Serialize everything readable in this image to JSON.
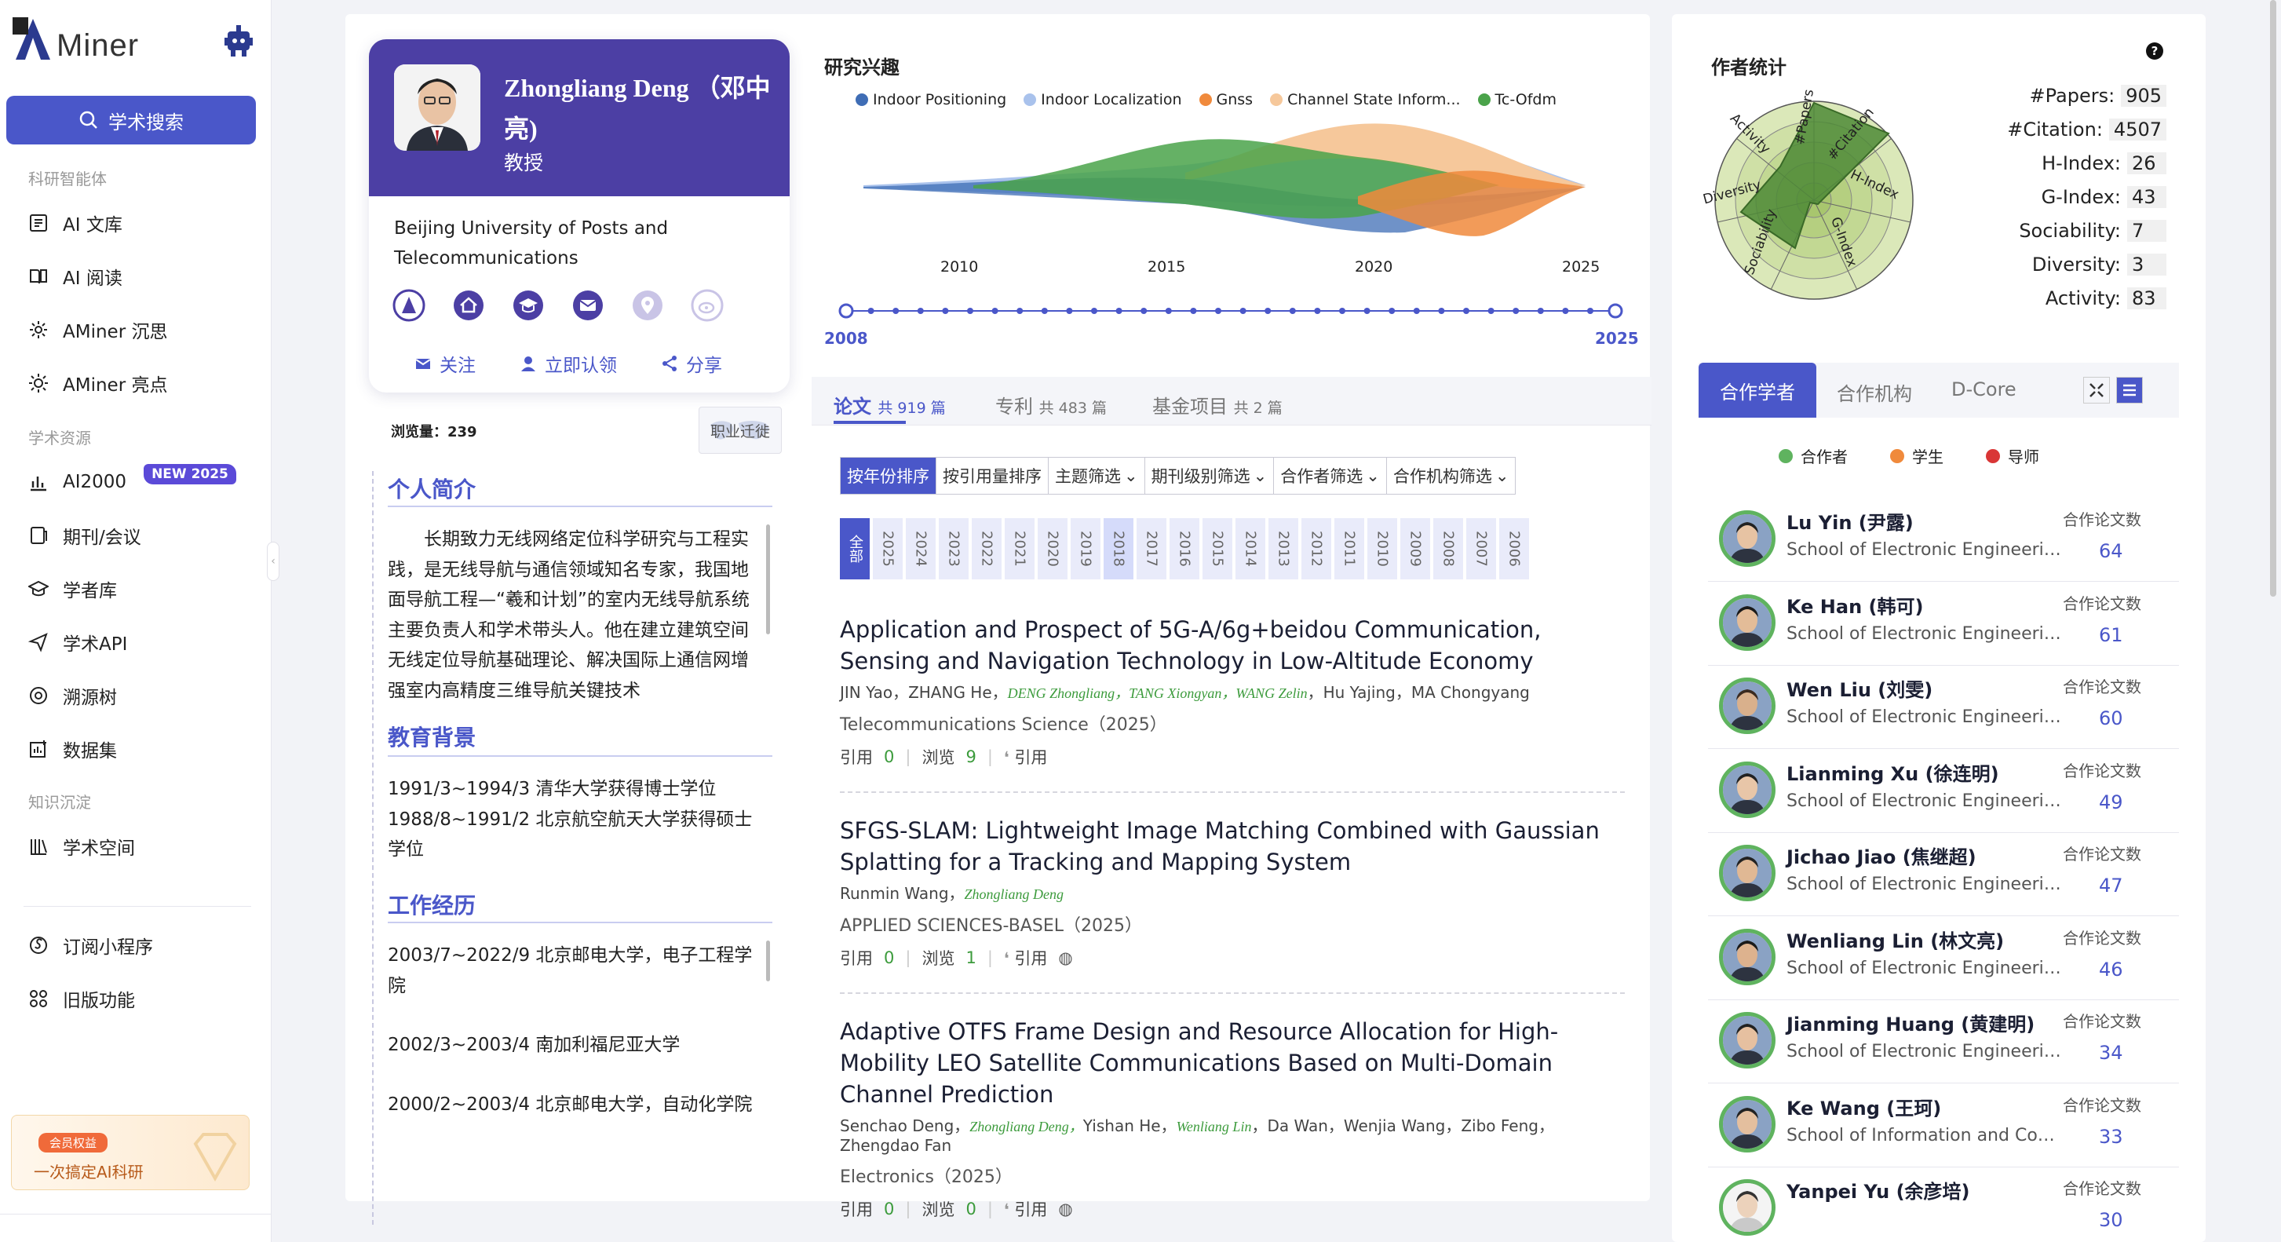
{
  "app": {
    "name": "Miner"
  },
  "sidebar": {
    "search_label": "学术搜索",
    "sections": [
      "科研智能体",
      "学术资源",
      "知识沉淀"
    ],
    "items": [
      {
        "label": "AI 文库",
        "icon": "doc-icon"
      },
      {
        "label": "AI 阅读",
        "icon": "book-icon"
      },
      {
        "label": "AMiner 沉思",
        "icon": "gear-icon"
      },
      {
        "label": "AMiner 亮点",
        "icon": "sun-icon"
      },
      {
        "label": "AI2000",
        "icon": "bar-chart-icon",
        "badge": "NEW 2025"
      },
      {
        "label": "期刊/会议",
        "icon": "journal-icon"
      },
      {
        "label": "学者库",
        "icon": "cap-icon"
      },
      {
        "label": "学术API",
        "icon": "send-icon"
      },
      {
        "label": "溯源树",
        "icon": "at-icon"
      },
      {
        "label": "数据集",
        "icon": "dataset-icon"
      },
      {
        "label": "学术空间",
        "icon": "library-icon"
      },
      {
        "label": "订阅小程序",
        "icon": "miniapp-icon"
      },
      {
        "label": "旧版功能",
        "icon": "grid-icon"
      }
    ],
    "promo": {
      "tag": "会员权益",
      "text": "一次搞定AI科研"
    }
  },
  "profile": {
    "name": "Zhongliang Deng （邓中亮)",
    "title": "教授",
    "affiliation": "Beijing University of Posts and Telecommunications",
    "actions": [
      "关注",
      "立即认领",
      "分享"
    ],
    "views_label": "浏览量：",
    "views": "239",
    "career_btn": "职业迁徙",
    "bio_title": "个人简介",
    "bio": "长期致力无线网络定位科学研究与工程实践，是无线导航与通信领域知名专家，我国地面导航工程—“羲和计划”的室内无线导航系统主要负责人和学术带头人。他在建立建筑空间无线定位导航基础理论、解决国际上通信网增强室内高精度三维导航关键技术",
    "edu_title": "教育背景",
    "edu": [
      "1991/3~1994/3 清华大学获得博士学位",
      "1988/8~1991/2 北京航空航天大学获得硕士学位"
    ],
    "work_title": "工作经历",
    "work": [
      "2003/7~2022/9 北京邮电大学，电子工程学院",
      "2002/3~2003/4 南加利福尼亚大学",
      "2000/2~2003/4 北京邮电大学，自动化学院"
    ]
  },
  "interests": {
    "title": "研究兴趣",
    "series": [
      {
        "name": "Indoor Positioning",
        "color": "#3f6db5"
      },
      {
        "name": "Indoor Localization",
        "color": "#a9c2ec"
      },
      {
        "name": "Gnss",
        "color": "#f08a3c"
      },
      {
        "name": "Channel State Inform...",
        "color": "#f6c89b"
      },
      {
        "name": "Tc-Ofdm",
        "color": "#4aa34a"
      }
    ],
    "axis_ticks": [
      "2010",
      "2015",
      "2020",
      "2025"
    ],
    "range_start": "2008",
    "range_end": "2025"
  },
  "tabs": [
    {
      "label": "论文",
      "count": "共 919 篇"
    },
    {
      "label": "专利",
      "count": "共 483 篇"
    },
    {
      "label": "基金项目",
      "count": "共 2 篇"
    }
  ],
  "filters": [
    "按年份排序",
    "按引用量排序",
    "主题筛选",
    "期刊级别筛选",
    "合作者筛选",
    "合作机构筛选"
  ],
  "years": [
    "全部",
    "2025",
    "2024",
    "2023",
    "2022",
    "2021",
    "2020",
    "2019",
    "2018",
    "2017",
    "2016",
    "2015",
    "2014",
    "2013",
    "2012",
    "2011",
    "2010",
    "2009",
    "2008",
    "2007",
    "2006"
  ],
  "papers": [
    {
      "title": "Application and Prospect of 5G-A/6g+beidou Communication, Sensing and Navigation Technology in Low-Altitude Economy",
      "authors_pre": "JIN Yao，ZHANG He，",
      "authors_hl": "DENG Zhongliang，TANG Xiongyan，WANG Zelin",
      "authors_post": "，Hu Yajing，MA Chongyang",
      "venue": "Telecommunications Science（2025）",
      "cite_label": "引用",
      "cite": "0",
      "view_label": "浏览",
      "views": "9",
      "quote": "引用"
    },
    {
      "title": "SFGS-SLAM: Lightweight Image Matching Combined with Gaussian Splatting for a Tracking and Mapping System",
      "authors_pre": "Runmin Wang，",
      "authors_hl": "Zhongliang Deng",
      "authors_post": "",
      "venue": "APPLIED SCIENCES-BASEL（2025）",
      "cite_label": "引用",
      "cite": "0",
      "view_label": "浏览",
      "views": "1",
      "quote": "引用"
    },
    {
      "title": "Adaptive OTFS Frame Design and Resource Allocation for High-Mobility LEO Satellite Communications Based on Multi-Domain Channel Prediction",
      "authors_pre": "Senchao Deng，",
      "authors_hl": "Zhongliang Deng，",
      "authors_mid": "Yishan He，",
      "authors_hl2": "Wenliang Lin",
      "authors_post": "，Da Wan，Wenjia Wang，Zibo Feng，Zhengdao Fan",
      "venue": "Electronics（2025）",
      "cite_label": "引用",
      "cite": "0",
      "view_label": "浏览",
      "views": "0",
      "quote": "引用"
    }
  ],
  "stats": {
    "title": "作者统计",
    "rows": [
      {
        "label": "#Papers:",
        "value": "905"
      },
      {
        "label": "#Citation:",
        "value": "4507"
      },
      {
        "label": "H-Index:",
        "value": "26"
      },
      {
        "label": "G-Index:",
        "value": "43"
      },
      {
        "label": "Sociability:",
        "value": "7"
      },
      {
        "label": "Diversity:",
        "value": "3"
      },
      {
        "label": "Activity:",
        "value": "83"
      }
    ],
    "radar_axes": [
      "#Papers",
      "#Citation",
      "H-Index",
      "G-Index",
      "Sociability",
      "Diversity",
      "Activity"
    ]
  },
  "coauthor_tabs": [
    "合作学者",
    "合作机构",
    "D-Core"
  ],
  "coauthor_legend": [
    {
      "label": "合作者",
      "color": "#5fb35f"
    },
    {
      "label": "学生",
      "color": "#f08a3c"
    },
    {
      "label": "导师",
      "color": "#d93636"
    }
  ],
  "coauthors": [
    {
      "name": "Lu Yin (尹露)",
      "org": "School of Electronic Engineering...",
      "label": "合作论文数",
      "count": "64"
    },
    {
      "name": "Ke Han (韩可)",
      "org": "School of Electronic Engineering...",
      "label": "合作论文数",
      "count": "61"
    },
    {
      "name": "Wen Liu (刘雯)",
      "org": "School of Electronic Engineering...",
      "label": "合作论文数",
      "count": "60"
    },
    {
      "name": "Lianming Xu (徐连明)",
      "org": "School of Electronic Engineering...",
      "label": "合作论文数",
      "count": "49"
    },
    {
      "name": "Jichao Jiao (焦继超)",
      "org": "School of Electronic Engineering...",
      "label": "合作论文数",
      "count": "47"
    },
    {
      "name": "Wenliang Lin (林文亮)",
      "org": "School of Electronic Engineering...",
      "label": "合作论文数",
      "count": "46"
    },
    {
      "name": "Jianming Huang (黄建明)",
      "org": "School of Electronic Engineering...",
      "label": "合作论文数",
      "count": "34"
    },
    {
      "name": "Ke Wang (王珂)",
      "org": "School of Information and Com...",
      "label": "合作论文数",
      "count": "33"
    },
    {
      "name": "Yanpei Yu (余彦培)",
      "org": "",
      "label": "合作论文数",
      "count": "30"
    }
  ]
}
